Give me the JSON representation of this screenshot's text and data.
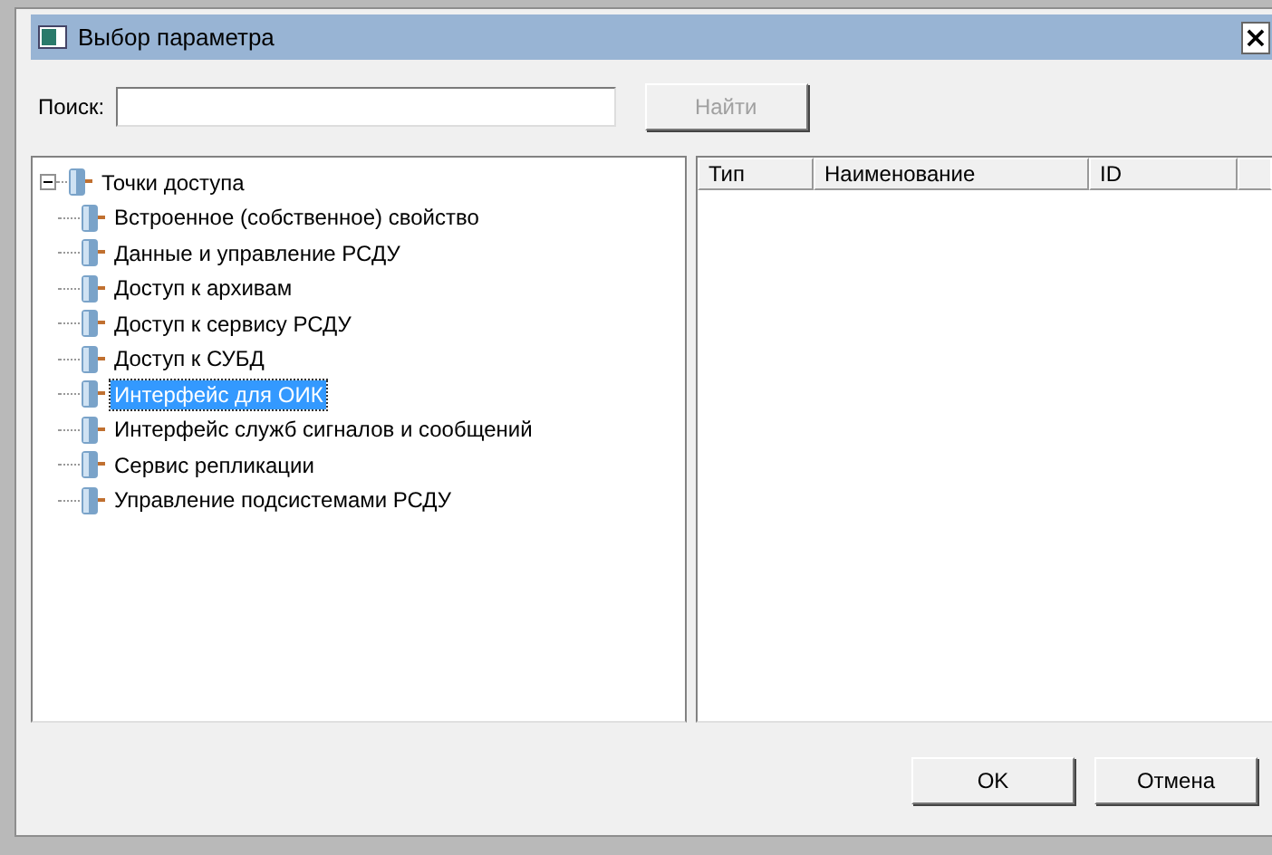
{
  "window": {
    "title": "Выбор параметра",
    "close": "×"
  },
  "search": {
    "label": "Поиск:",
    "button": {
      "label": "Найти",
      "disabled": true
    }
  },
  "tree": {
    "label": "Точки доступа",
    "expanded": true,
    "selected": false,
    "children": [
      {
        "label": "Встроенное (собственное) свойство",
        "selected": false
      },
      {
        "label": "Данные и управление РСДУ",
        "selected": false
      },
      {
        "label": "Доступ к архивам",
        "selected": false
      },
      {
        "label": "Доступ к сервису РСДУ",
        "selected": false
      },
      {
        "label": "Доступ к СУБД",
        "selected": false
      },
      {
        "label": "Интерфейс для ОИК",
        "selected": true
      },
      {
        "label": "Интерфейс служб сигналов и сообщений",
        "selected": false
      },
      {
        "label": "Сервис репликации",
        "selected": false
      },
      {
        "label": "Управление подсистемами РСДУ",
        "selected": false
      }
    ]
  },
  "table": {
    "columns": [
      "Тип",
      "Наименование",
      "ID"
    ]
  },
  "buttons": [
    "OK",
    "Отмена"
  ]
}
